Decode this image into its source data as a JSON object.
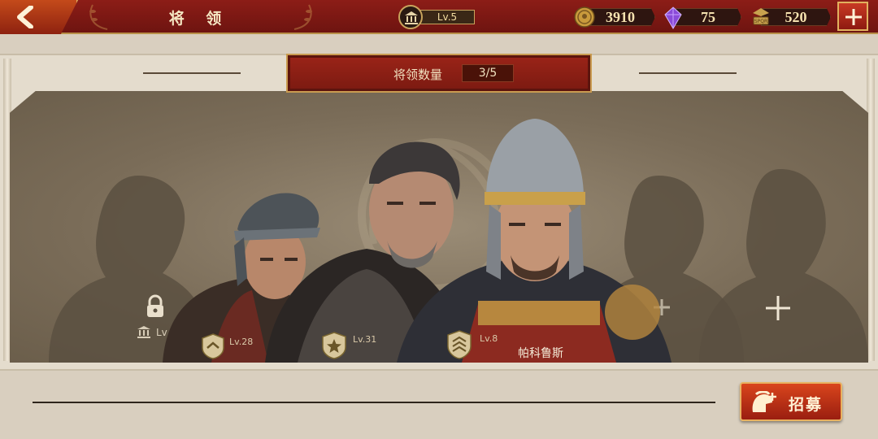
{
  "header": {
    "title": "将 领",
    "building_level": "Lv.5",
    "gold": "3910",
    "gems": "75",
    "food": "520"
  },
  "roster": {
    "count_label": "将领数量",
    "count_value": "3/5"
  },
  "slots": {
    "locked_level": "Lv"
  },
  "generals": [
    {
      "level": "Lv.28"
    },
    {
      "level": "Lv.31"
    },
    {
      "level": "Lv.8",
      "name": "帕科鲁斯"
    }
  ],
  "footer": {
    "recruit_label": "招募"
  },
  "colors": {
    "header_red": "#8c1d17",
    "gold_trim": "#c9a45c",
    "parchment": "#e4dccd",
    "recruit_orange": "#d9451c"
  }
}
